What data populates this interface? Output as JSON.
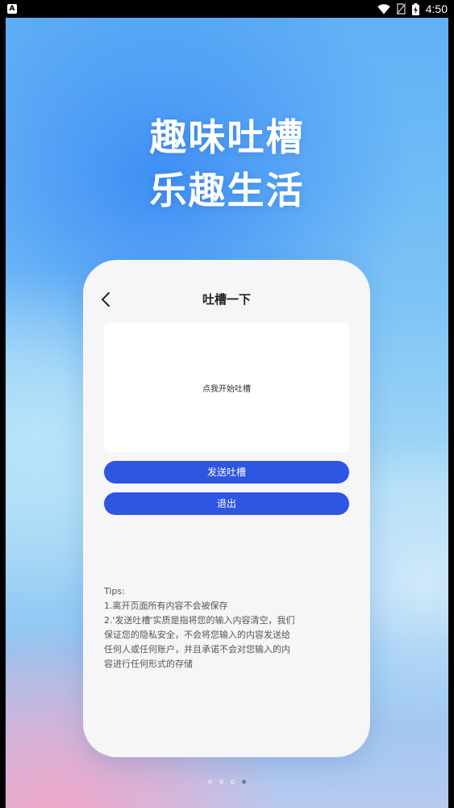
{
  "status_bar": {
    "left_icon_letter": "A",
    "time": "4:50",
    "icons": [
      "wifi-icon",
      "no-sim-icon",
      "battery-charging-icon"
    ]
  },
  "headline": {
    "line1": "趣味吐槽",
    "line2": "乐趣生活"
  },
  "phone": {
    "nav_title": "吐槽一下",
    "input_placeholder": "点我开始吐槽",
    "send_button": "发送吐槽",
    "exit_button": "退出",
    "tips": {
      "heading": "Tips:",
      "lines": [
        "1.离开页面所有内容不会被保存",
        "2.'发送吐槽'实质是指将您的输入内容清空，我们",
        "保证您的隐私安全，不会将您输入的内容发送给",
        "任何人或任何账户，并且承诺不会对您输入的内",
        "容进行任何形式的存储"
      ]
    }
  },
  "pager": {
    "count": 4,
    "active_index": 3
  },
  "colors": {
    "accent": "#2f55e3",
    "card_bg": "#f6f6f8"
  }
}
